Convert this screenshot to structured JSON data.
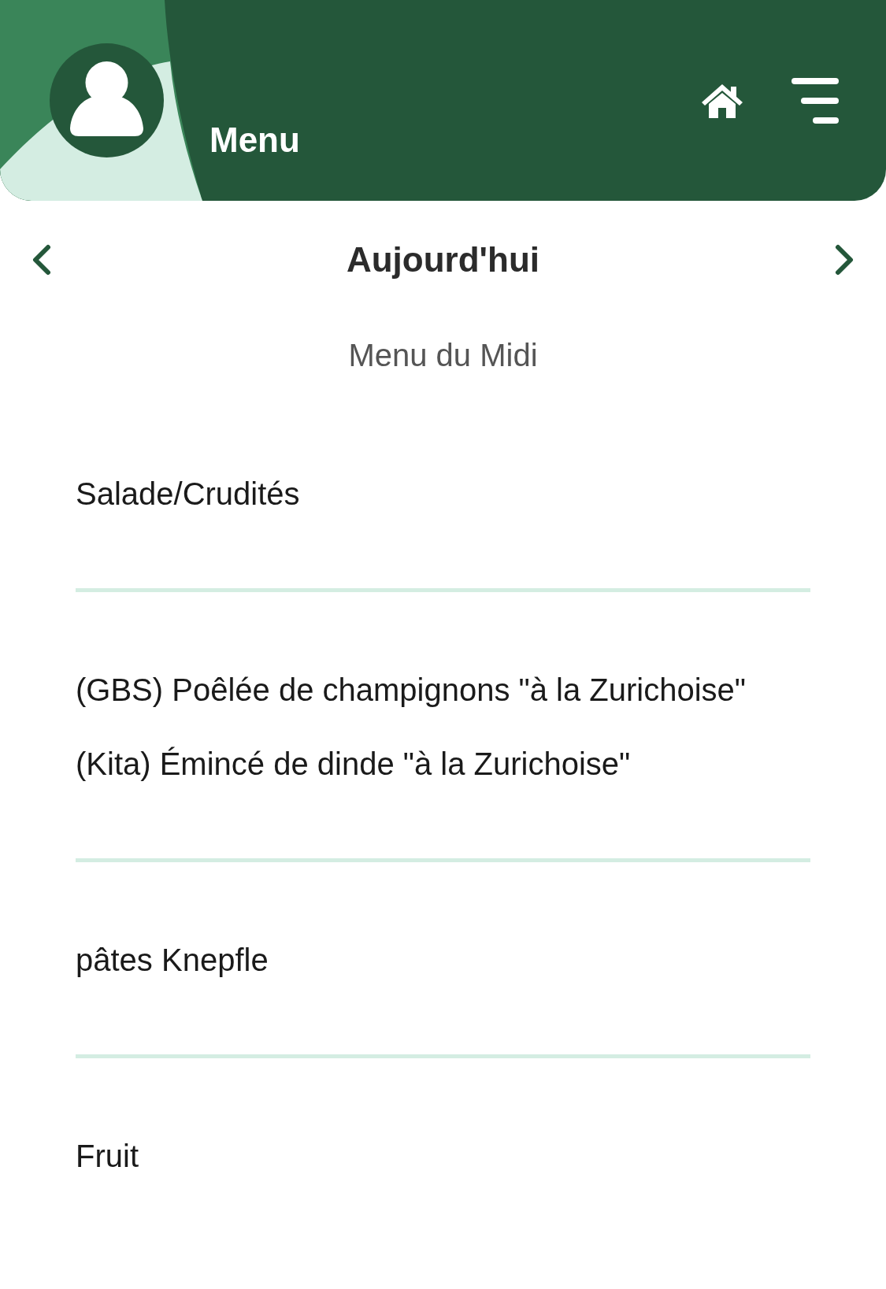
{
  "header": {
    "title": "Menu"
  },
  "nav": {
    "date": "Aujourd'hui"
  },
  "section_title": "Menu du Midi",
  "items": [
    {
      "lines": [
        "Salade/Crudités"
      ]
    },
    {
      "lines": [
        "(GBS) Poêlée de champignons \"à la Zurichoise\"",
        "(Kita) Émincé de dinde \"à la Zurichoise\""
      ]
    },
    {
      "lines": [
        "pâtes Knepfle"
      ]
    },
    {
      "lines": [
        "Fruit"
      ]
    }
  ]
}
